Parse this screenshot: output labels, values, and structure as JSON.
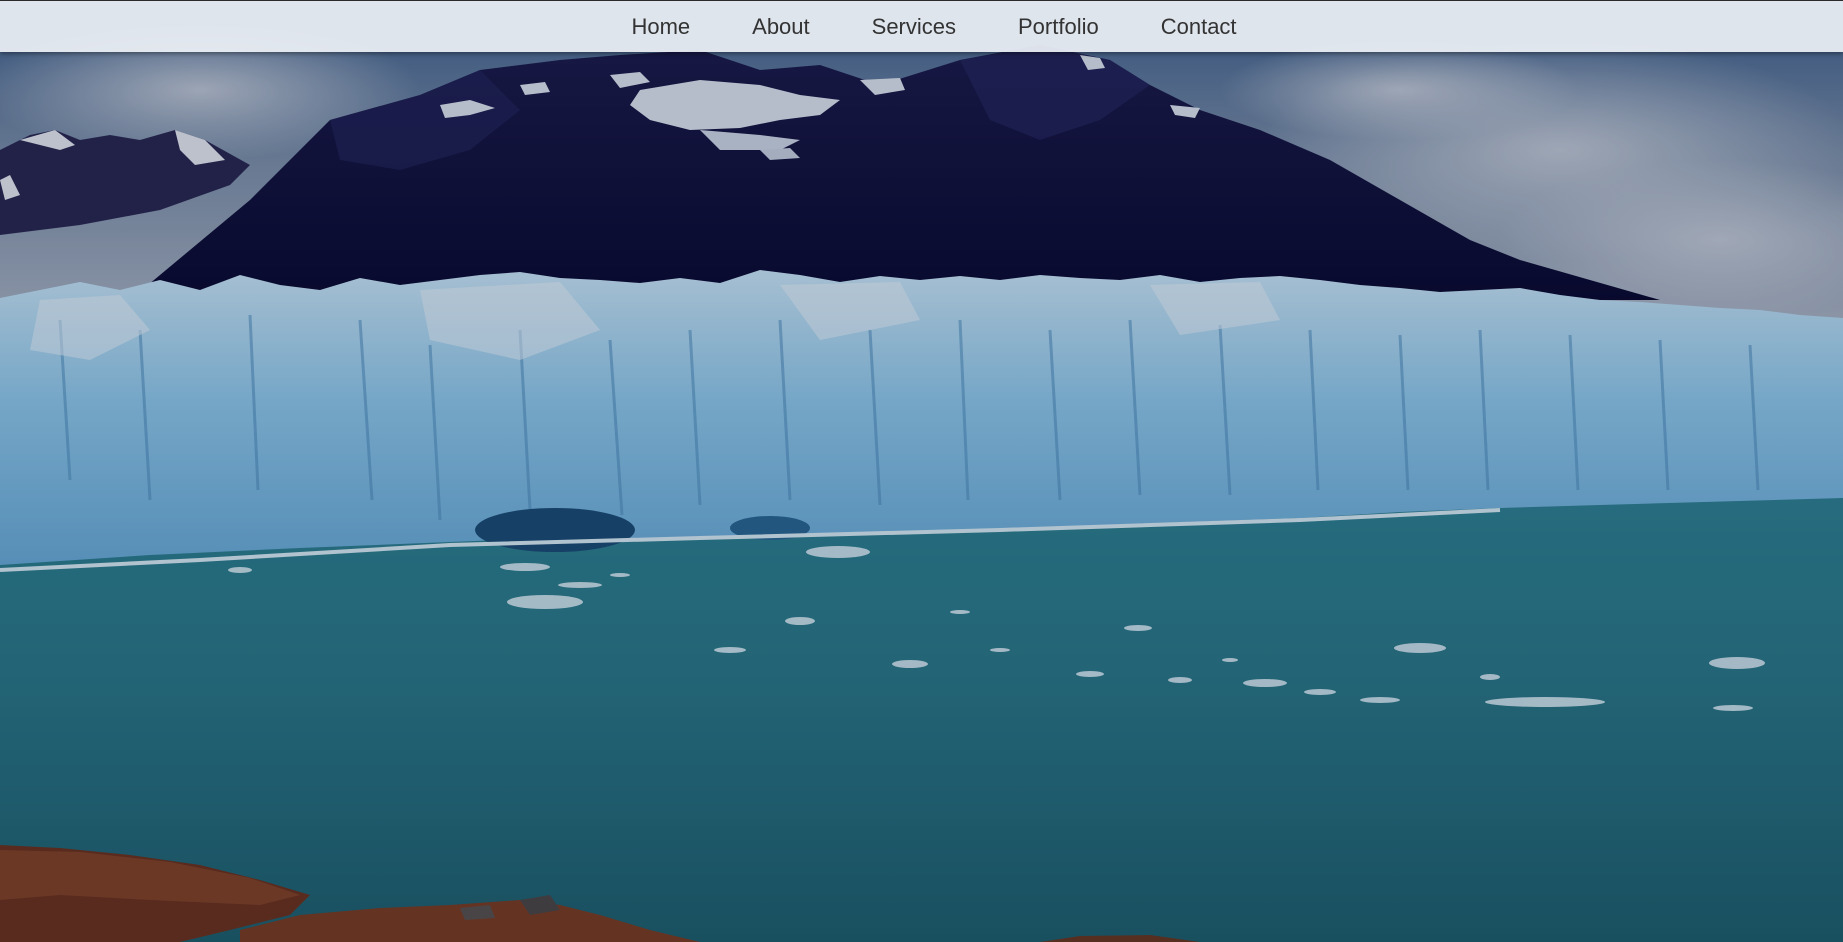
{
  "nav": {
    "items": [
      {
        "label": "Home"
      },
      {
        "label": "About"
      },
      {
        "label": "Services"
      },
      {
        "label": "Portfolio"
      },
      {
        "label": "Contact"
      }
    ]
  },
  "hero": {
    "image": "glacier-mountain-lake-landscape",
    "overlay": "dark-tint"
  },
  "colors": {
    "navbar_bg": "#eceff5",
    "nav_text": "#333333",
    "sky": "#8a9fb3",
    "mountain": "#0c0f3a",
    "glacier": "#9fd3ef",
    "water": "#2b7a8a",
    "rocks": "#7a3b22"
  }
}
